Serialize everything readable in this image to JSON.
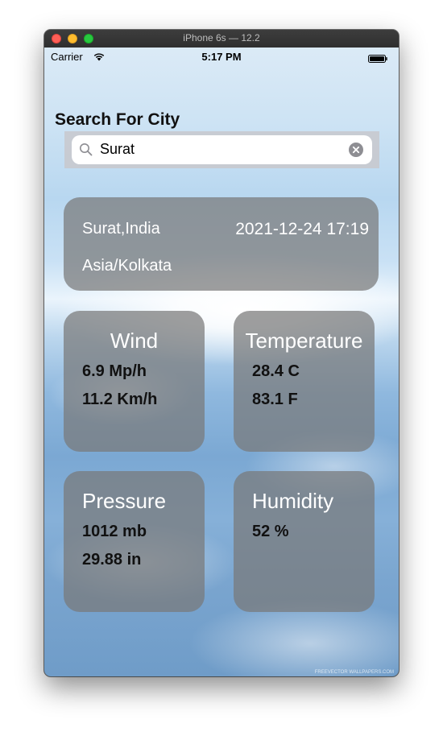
{
  "window": {
    "title": "iPhone 6s — 12.2"
  },
  "status_bar": {
    "carrier": "Carrier",
    "time": "5:17 PM"
  },
  "header": {
    "title": "Search For City"
  },
  "search": {
    "value": "Surat"
  },
  "location": {
    "city": "Surat,India",
    "datetime": "2021-12-24 17:19",
    "timezone": "Asia/Kolkata"
  },
  "wind": {
    "title": "Wind",
    "line1": "6.9 Mp/h",
    "line2": "11.2 Km/h"
  },
  "temperature": {
    "title": "Temperature",
    "line1": "28.4 C",
    "line2": "83.1 F"
  },
  "pressure": {
    "title": "Pressure",
    "line1": "1012 mb",
    "line2": "29.88 in"
  },
  "humidity": {
    "title": "Humidity",
    "line1": "52 %"
  },
  "watermark": "FREEVECTOR WALLPAPERS.COM",
  "icons": {
    "wifi": "wifi-icon",
    "battery": "battery-icon",
    "search": "search-icon",
    "clear": "clear-icon"
  },
  "colors": {
    "card_background": "#787878",
    "card_title": "#ffffff",
    "card_values": "#111111"
  }
}
